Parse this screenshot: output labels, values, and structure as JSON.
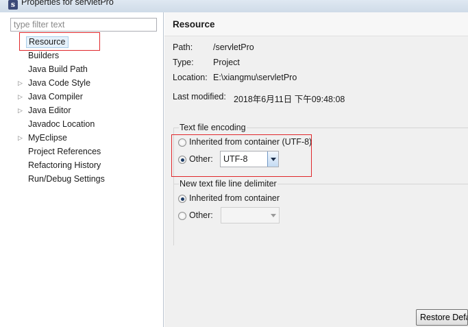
{
  "window": {
    "title": "Properties for servletPro",
    "app_icon_letter": "s"
  },
  "left_pane": {
    "filter_placeholder": "type filter text",
    "tree": [
      {
        "label": "Resource",
        "expandable": false,
        "selected": true
      },
      {
        "label": "Builders",
        "expandable": false
      },
      {
        "label": "Java Build Path",
        "expandable": false
      },
      {
        "label": "Java Code Style",
        "expandable": true
      },
      {
        "label": "Java Compiler",
        "expandable": true
      },
      {
        "label": "Java Editor",
        "expandable": true
      },
      {
        "label": "Javadoc Location",
        "expandable": false
      },
      {
        "label": "MyEclipse",
        "expandable": true
      },
      {
        "label": "Project References",
        "expandable": false
      },
      {
        "label": "Refactoring History",
        "expandable": false
      },
      {
        "label": "Run/Debug Settings",
        "expandable": false
      }
    ]
  },
  "page": {
    "title": "Resource",
    "path_label": "Path:",
    "path_value": "/servletPro",
    "type_label": "Type:",
    "type_value": "Project",
    "location_label": "Location:",
    "location_value": "E:\\xiangmu\\servletPro",
    "modified_label": "Last modified:",
    "modified_value": "2018年6月11日 下午09:48:08"
  },
  "encoding_group": {
    "title": "Text file encoding",
    "inherited_label": "Inherited from container (UTF-8)",
    "inherited_checked": false,
    "other_label": "Other:",
    "other_checked": true,
    "other_value": "UTF-8"
  },
  "delimiter_group": {
    "title": "New text file line delimiter",
    "inherited_label": "Inherited from container",
    "inherited_checked": true,
    "other_label": "Other:",
    "other_checked": false,
    "other_value": ""
  },
  "buttons": {
    "restore_defaults": "Restore Defa"
  },
  "colors": {
    "highlight_annotation": "#e0262a",
    "selection_bg": "#e5f1fb",
    "pane_bg": "#f0f0f0"
  }
}
